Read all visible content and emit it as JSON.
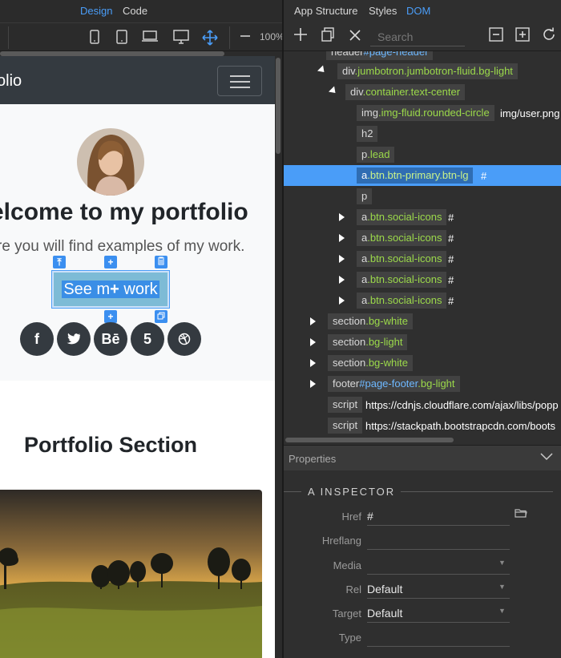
{
  "left_tabs": {
    "design": "Design",
    "code": "Code"
  },
  "toolbar": {
    "zoom": "100%"
  },
  "preview": {
    "brand": "olio",
    "hero_title": "elcome to my portfolio",
    "hero_lead": "re you will find examples of my work.",
    "cta_before": "See m",
    "cta_after": " work",
    "social": [
      "f",
      "t",
      "Bē",
      "5",
      "◎"
    ],
    "portfolio_title": "Portfolio Section"
  },
  "right_tabs": {
    "app_structure": "App Structure",
    "styles": "Styles",
    "dom": "DOM"
  },
  "search_placeholder": "Search",
  "tree": [
    {
      "tag": "header",
      "cls": "",
      "id": "#page-header",
      "attr": ""
    },
    {
      "tag": "div",
      "cls": ".jumbotron.jumbotron-fluid.bg-light",
      "id": "",
      "attr": ""
    },
    {
      "tag": "div",
      "cls": ".container.text-center",
      "id": "",
      "attr": ""
    },
    {
      "tag": "img",
      "cls": ".img-fluid.rounded-circle",
      "id": "",
      "attr": "img/user.png"
    },
    {
      "tag": "h2",
      "cls": "",
      "id": "",
      "attr": ""
    },
    {
      "tag": "p",
      "cls": ".lead",
      "id": "",
      "attr": ""
    },
    {
      "tag": "a",
      "cls": ".btn.btn-primary.btn-lg",
      "id": "",
      "attr": "#"
    },
    {
      "tag": "p",
      "cls": "",
      "id": "",
      "attr": ""
    },
    {
      "tag": "a",
      "cls": ".btn.social-icons",
      "id": "",
      "attr": "#"
    },
    {
      "tag": "a",
      "cls": ".btn.social-icons",
      "id": "",
      "attr": "#"
    },
    {
      "tag": "a",
      "cls": ".btn.social-icons",
      "id": "",
      "attr": "#"
    },
    {
      "tag": "a",
      "cls": ".btn.social-icons",
      "id": "",
      "attr": "#"
    },
    {
      "tag": "a",
      "cls": ".btn.social-icons",
      "id": "",
      "attr": "#"
    },
    {
      "tag": "section",
      "cls": ".bg-white",
      "id": "",
      "attr": ""
    },
    {
      "tag": "section",
      "cls": ".bg-light",
      "id": "",
      "attr": ""
    },
    {
      "tag": "section",
      "cls": ".bg-white",
      "id": "",
      "attr": ""
    },
    {
      "tag": "footer",
      "cls": ".bg-light",
      "id": "#page-footer",
      "attr": ""
    },
    {
      "tag": "script",
      "cls": "",
      "id": "",
      "attr": "https://cdnjs.cloudflare.com/ajax/libs/popp"
    },
    {
      "tag": "script",
      "cls": "",
      "id": "",
      "attr": "https://stackpath.bootstrapcdn.com/boots"
    }
  ],
  "properties": {
    "header": "Properties",
    "inspector_title": "A INSPECTOR",
    "fields": [
      {
        "label": "Href",
        "value": "#"
      },
      {
        "label": "Hreflang",
        "value": ""
      },
      {
        "label": "Media",
        "value": ""
      },
      {
        "label": "Rel",
        "value": "Default"
      },
      {
        "label": "Target",
        "value": "Default"
      },
      {
        "label": "Type",
        "value": ""
      }
    ]
  }
}
